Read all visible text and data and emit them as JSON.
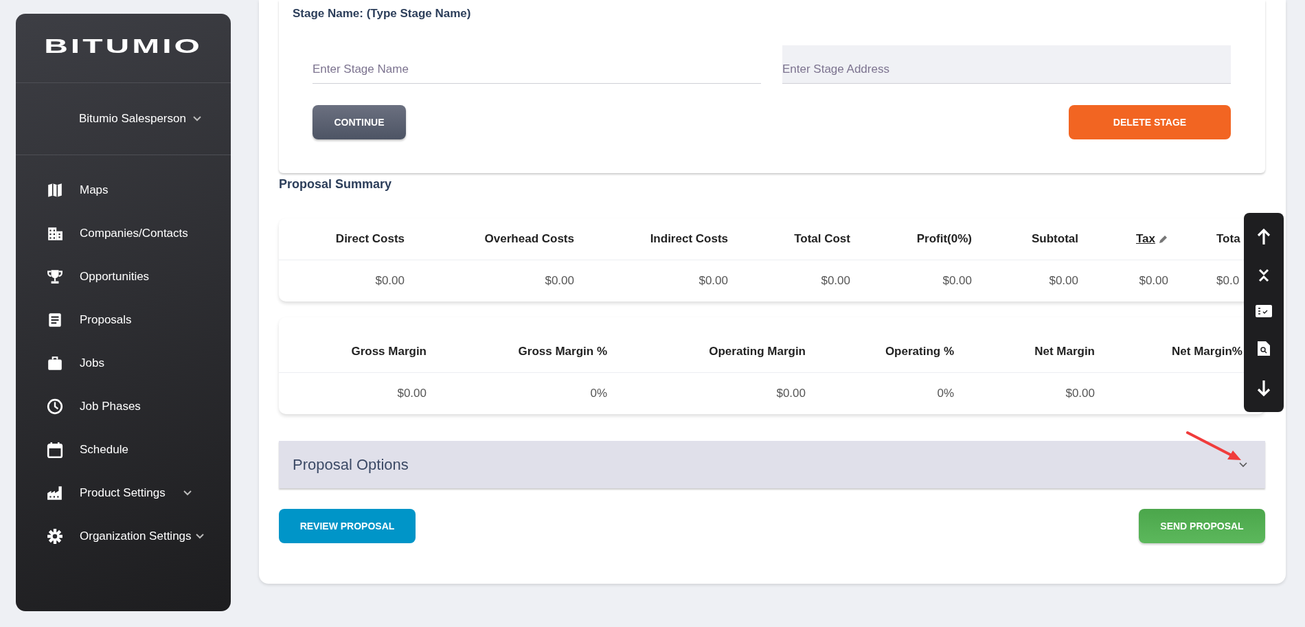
{
  "sidebar": {
    "logo": "BITUMIO",
    "user": {
      "name": "Bitumio Salesperson",
      "expandable": true
    },
    "items": [
      {
        "label": "Maps",
        "expandable": false
      },
      {
        "label": "Companies/Contacts",
        "expandable": false
      },
      {
        "label": "Opportunities",
        "expandable": false
      },
      {
        "label": "Proposals",
        "expandable": false
      },
      {
        "label": "Jobs",
        "expandable": false
      },
      {
        "label": "Job Phases",
        "expandable": false
      },
      {
        "label": "Schedule",
        "expandable": false
      },
      {
        "label": "Product Settings",
        "expandable": true
      },
      {
        "label": "Organization Settings",
        "expandable": true
      }
    ]
  },
  "stage": {
    "title": "Stage Name: (Type Stage Name)",
    "name_field": {
      "placeholder": "Enter Stage Name"
    },
    "address_field": {
      "placeholder": "Enter Stage Address"
    },
    "continue_button": "CONTINUE",
    "delete_button": "DELETE STAGE"
  },
  "summary": {
    "title": "Proposal Summary",
    "cost_table": {
      "columns": [
        {
          "label": "Direct Costs",
          "editable": false
        },
        {
          "label": "Overhead Costs",
          "editable": false
        },
        {
          "label": "Indirect Costs",
          "editable": false
        },
        {
          "label": "Total Cost",
          "editable": false
        },
        {
          "label": "Profit(0%)",
          "editable": false
        },
        {
          "label": "Subtotal",
          "editable": false
        },
        {
          "label": "Tax",
          "editable": true
        },
        {
          "label": "Tota",
          "editable": false
        }
      ],
      "values": [
        "$0.00",
        "$0.00",
        "$0.00",
        "$0.00",
        "$0.00",
        "$0.00",
        "$0.00",
        "$0.0"
      ]
    },
    "margin_table": {
      "columns": [
        {
          "label": "Gross Margin",
          "editable": false
        },
        {
          "label": "Gross Margin %",
          "editable": false
        },
        {
          "label": "Operating Margin",
          "editable": false
        },
        {
          "label": "Operating %",
          "editable": false
        },
        {
          "label": "Net Margin",
          "editable": false
        },
        {
          "label": "Net Margin%",
          "editable": false
        }
      ],
      "values": [
        "$0.00",
        "0%",
        "$0.00",
        "0%",
        "$0.00"
      ]
    }
  },
  "options": {
    "title": "Proposal Options",
    "expanded": false
  },
  "actions": {
    "review_button": "REVIEW PROPOSAL",
    "send_button": "SEND PROPOSAL"
  }
}
